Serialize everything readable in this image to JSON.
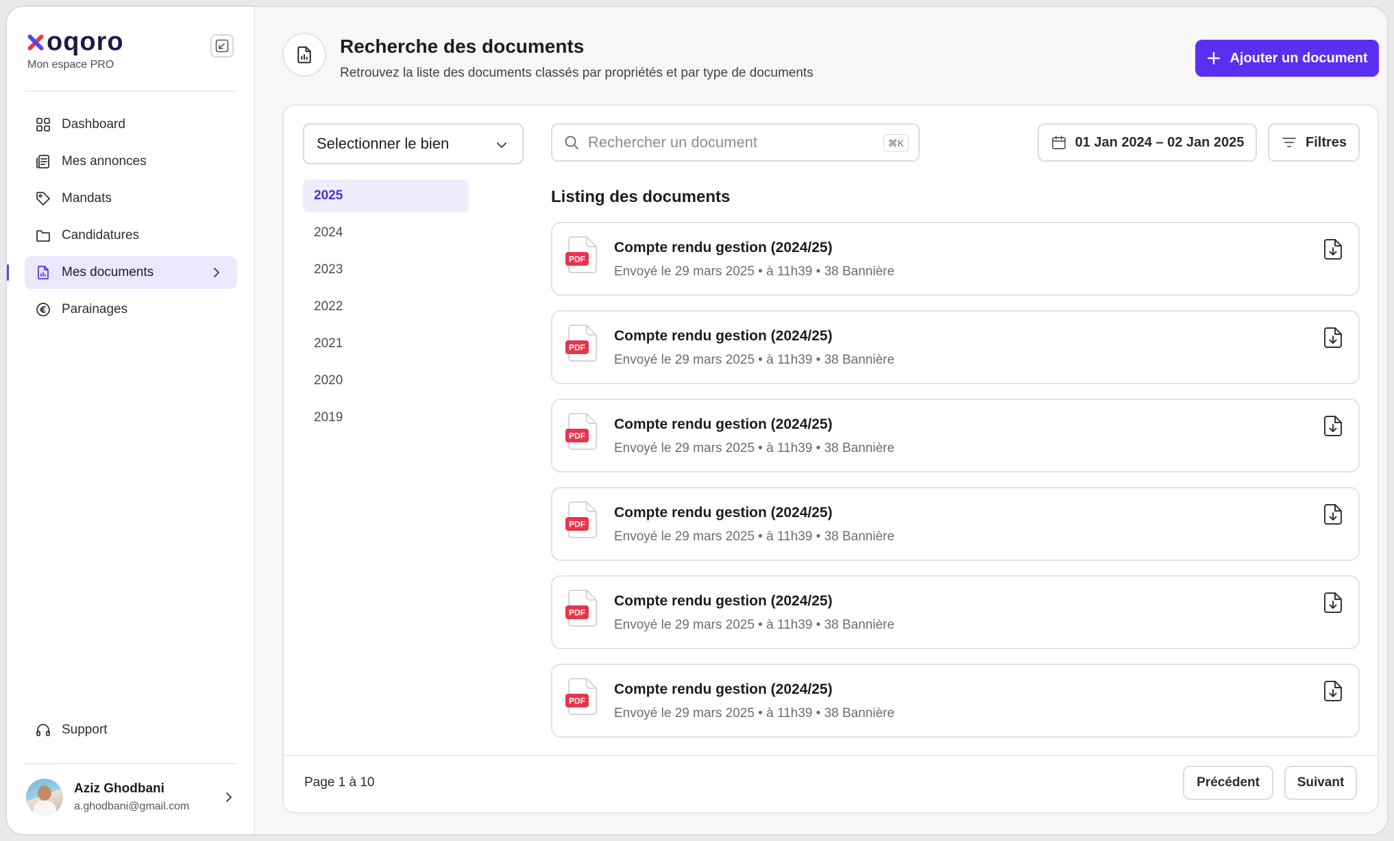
{
  "brand": {
    "name": "oqoro",
    "subtitle": "Mon espace PRO"
  },
  "sidebar": {
    "items": [
      {
        "label": "Dashboard",
        "icon": "grid-icon"
      },
      {
        "label": "Mes annonces",
        "icon": "listing-icon"
      },
      {
        "label": "Mandats",
        "icon": "tag-icon"
      },
      {
        "label": "Candidatures",
        "icon": "folder-icon"
      },
      {
        "label": "Mes documents",
        "icon": "document-chart-icon",
        "active": true
      },
      {
        "label": "Parainages",
        "icon": "euro-icon"
      }
    ],
    "support_label": "Support"
  },
  "user": {
    "name": "Aziz Ghodbani",
    "email": "a.ghodbani@gmail.com"
  },
  "header": {
    "title": "Recherche des documents",
    "subtitle": "Retrouvez la liste des documents classés par propriétés et par type de documents",
    "add_button_label": "Ajouter un document"
  },
  "filters": {
    "property_select_label": "Selectionner le bien",
    "search_placeholder": "Rechercher un document",
    "search_shortcut": "⌘K",
    "date_range": "01 Jan 2024 – 02 Jan 2025",
    "filters_label": "Filtres"
  },
  "years": [
    "2025",
    "2024",
    "2023",
    "2022",
    "2021",
    "2020",
    "2019"
  ],
  "selected_year": "2025",
  "documents_title": "Listing des documents",
  "documents": [
    {
      "title": "Compte rendu gestion (2024/25)",
      "meta": "Envoyé le 29 mars 2025 • à 11h39 • 38 Bannière",
      "type": "PDF"
    },
    {
      "title": "Compte rendu gestion (2024/25)",
      "meta": "Envoyé le 29 mars 2025 • à 11h39 • 38 Bannière",
      "type": "PDF"
    },
    {
      "title": "Compte rendu gestion (2024/25)",
      "meta": "Envoyé le 29 mars 2025 • à 11h39 • 38 Bannière",
      "type": "PDF"
    },
    {
      "title": "Compte rendu gestion (2024/25)",
      "meta": "Envoyé le 29 mars 2025 • à 11h39 • 38 Bannière",
      "type": "PDF"
    },
    {
      "title": "Compte rendu gestion (2024/25)",
      "meta": "Envoyé le 29 mars 2025 • à 11h39 • 38 Bannière",
      "type": "PDF"
    },
    {
      "title": "Compte rendu gestion (2024/25)",
      "meta": "Envoyé le 29 mars 2025 • à 11h39 • 38 Bannière",
      "type": "PDF"
    }
  ],
  "pagination": {
    "info": "Page 1 à 10",
    "prev_label": "Précédent",
    "next_label": "Suivant"
  },
  "colors": {
    "accent": "#5b2ff0",
    "accent_light": "#ebe8fd",
    "pdf_red": "#e8334a",
    "logo_red": "#e53a4a"
  }
}
